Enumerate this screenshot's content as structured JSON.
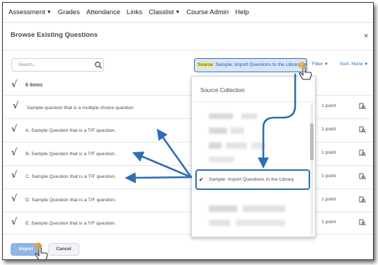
{
  "nav": {
    "items": [
      {
        "label": "Assessment",
        "dropdown": true
      },
      {
        "label": "Grades",
        "dropdown": false
      },
      {
        "label": "Attendance",
        "dropdown": false
      },
      {
        "label": "Links",
        "dropdown": false
      },
      {
        "label": "Classlist",
        "dropdown": true
      },
      {
        "label": "Course Admin",
        "dropdown": false
      },
      {
        "label": "Help",
        "dropdown": false
      }
    ]
  },
  "dialog": {
    "title": "Browse Existing Questions",
    "close_glyph": "×"
  },
  "toolbar": {
    "search_placeholder": "Search...",
    "source_prefix": "Source",
    "source_value": ": Sample: Import Questions to the Library",
    "filter_label": "Filter",
    "sort_label": "Sort: None"
  },
  "list": {
    "items_count": "6 items",
    "questions": [
      {
        "text": "Sample question that is a multiple choice question",
        "points": "1 point"
      },
      {
        "text": "A. Sample Question that is a T/F question.",
        "points": "1 point"
      },
      {
        "text": "B. Sample Question that is a T/F question.",
        "points": "1 point"
      },
      {
        "text": "C. Sample Question that is a T/F question.",
        "points": "1 point"
      },
      {
        "text": "D. Sample Question that is a T/F question.",
        "points": "1 point"
      },
      {
        "text": "E. Sample Question that is a T/F question.",
        "points": "1 point"
      }
    ]
  },
  "dropdown": {
    "title": "Source Collection",
    "selected": "Sample: Import Questions to the Library"
  },
  "footer": {
    "import_label": "Import",
    "cancel_label": "Cancel"
  },
  "colors": {
    "accent": "#1a6fc2",
    "arrow": "#2f6db5",
    "highlight": "#ffee58"
  }
}
